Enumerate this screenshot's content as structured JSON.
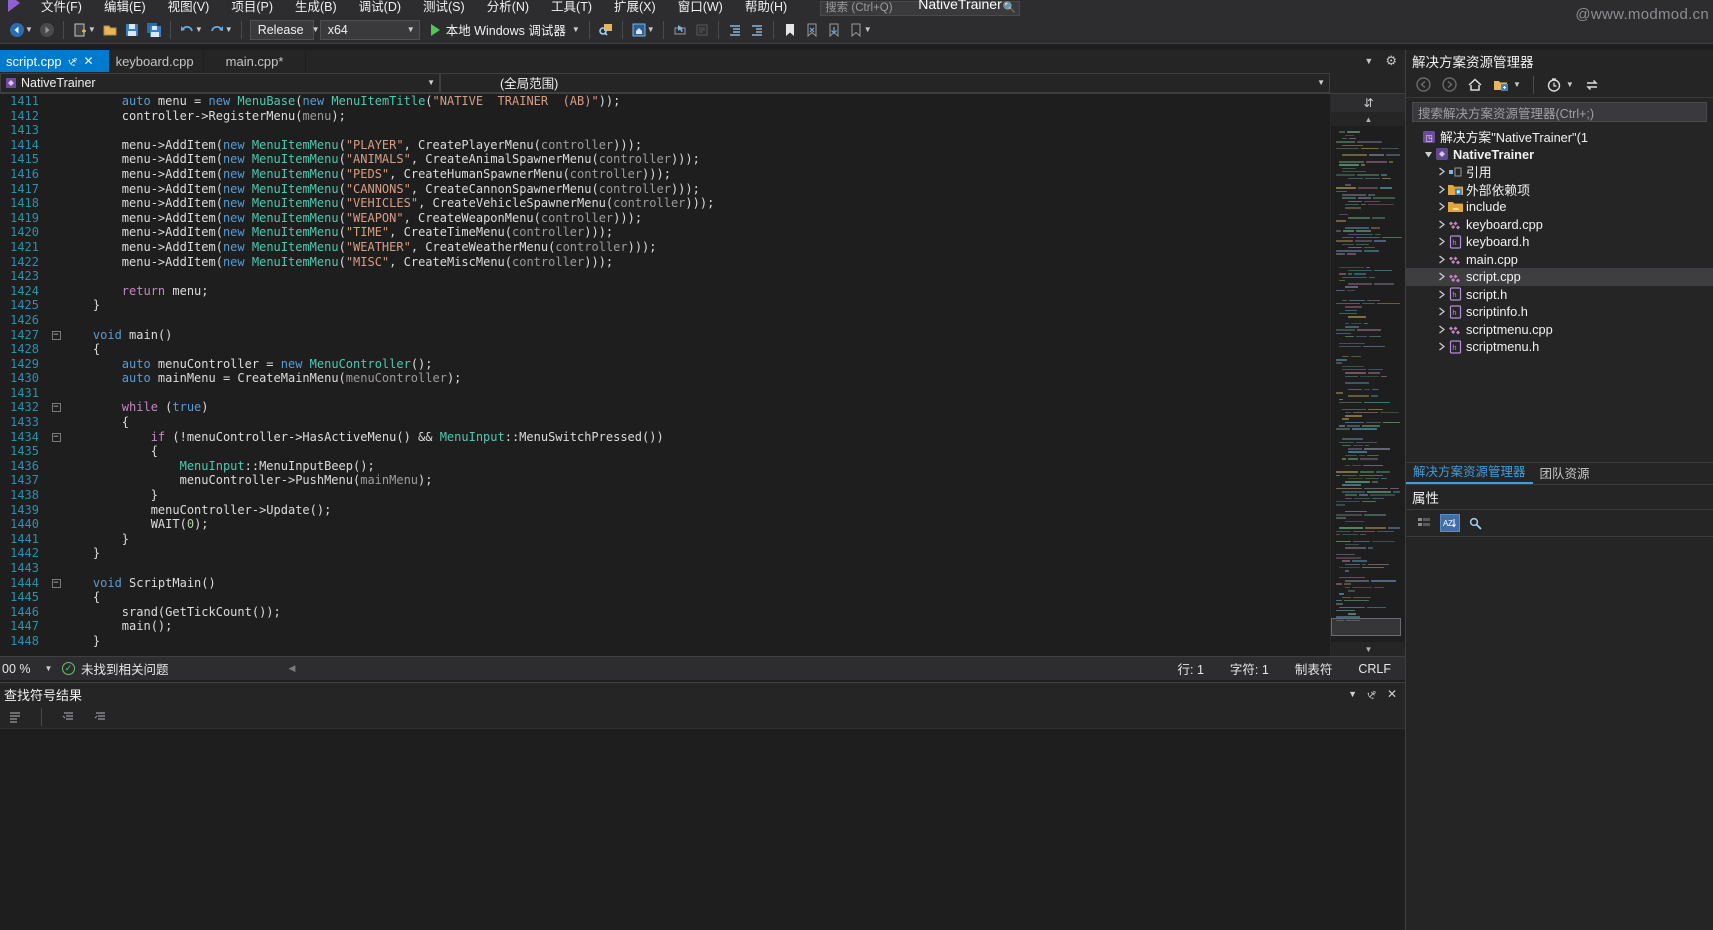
{
  "watermark": "@www.modmod.cn",
  "menubar": {
    "items": [
      {
        "label": "文件(F)"
      },
      {
        "label": "编辑(E)"
      },
      {
        "label": "视图(V)"
      },
      {
        "label": "项目(P)"
      },
      {
        "label": "生成(B)"
      },
      {
        "label": "调试(D)"
      },
      {
        "label": "测试(S)"
      },
      {
        "label": "分析(N)"
      },
      {
        "label": "工具(T)"
      },
      {
        "label": "扩展(X)"
      },
      {
        "label": "窗口(W)"
      },
      {
        "label": "帮助(H)"
      }
    ],
    "search_placeholder": "搜索 (Ctrl+Q)",
    "window_title": "NativeTrainer"
  },
  "toolbar": {
    "configuration": "Release",
    "platform": "x64",
    "debug_target": "本地 Windows 调试器",
    "icons": [
      "navigate-back-icon",
      "navigate-forward-icon",
      "new-file-icon",
      "open-file-icon",
      "save-icon",
      "save-all-icon",
      "undo-icon",
      "redo-icon"
    ]
  },
  "tabs": [
    {
      "label": "script.cpp",
      "active": true,
      "pinned": true,
      "closable": true
    },
    {
      "label": "keyboard.cpp",
      "active": false
    },
    {
      "label": "main.cpp*",
      "active": false
    }
  ],
  "navbar": {
    "project_scope": "NativeTrainer",
    "member_scope": "(全局范围)"
  },
  "editor": {
    "first_line": 1411,
    "lines": [
      {
        "n": 1411,
        "fold": "",
        "seg": [
          {
            "t": "        ",
            "c": "d"
          },
          {
            "t": "auto",
            "c": "k"
          },
          {
            "t": " menu = ",
            "c": "d"
          },
          {
            "t": "new",
            "c": "k"
          },
          {
            "t": " ",
            "c": "d"
          },
          {
            "t": "MenuBase",
            "c": "t"
          },
          {
            "t": "(",
            "c": "d"
          },
          {
            "t": "new",
            "c": "k"
          },
          {
            "t": " ",
            "c": "d"
          },
          {
            "t": "MenuItemTitle",
            "c": "t"
          },
          {
            "t": "(",
            "c": "d"
          },
          {
            "t": "\"NATIVE  TRAINER  (AB)\"",
            "c": "s"
          },
          {
            "t": "));",
            "c": "d"
          }
        ]
      },
      {
        "n": 1412,
        "fold": "",
        "seg": [
          {
            "t": "        controller->",
            "c": "d"
          },
          {
            "t": "RegisterMenu",
            "c": "d"
          },
          {
            "t": "(",
            "c": "d"
          },
          {
            "t": "menu",
            "c": "p"
          },
          {
            "t": ");",
            "c": "d"
          }
        ]
      },
      {
        "n": 1413,
        "fold": "",
        "seg": []
      },
      {
        "n": 1414,
        "fold": "",
        "seg": [
          {
            "t": "        menu->AddItem(",
            "c": "d"
          },
          {
            "t": "new",
            "c": "k"
          },
          {
            "t": " ",
            "c": "d"
          },
          {
            "t": "MenuItemMenu",
            "c": "t"
          },
          {
            "t": "(",
            "c": "d"
          },
          {
            "t": "\"PLAYER\"",
            "c": "s"
          },
          {
            "t": ", CreatePlayerMenu(",
            "c": "d"
          },
          {
            "t": "controller",
            "c": "p"
          },
          {
            "t": ")));",
            "c": "d"
          }
        ]
      },
      {
        "n": 1415,
        "fold": "",
        "seg": [
          {
            "t": "        menu->AddItem(",
            "c": "d"
          },
          {
            "t": "new",
            "c": "k"
          },
          {
            "t": " ",
            "c": "d"
          },
          {
            "t": "MenuItemMenu",
            "c": "t"
          },
          {
            "t": "(",
            "c": "d"
          },
          {
            "t": "\"ANIMALS\"",
            "c": "s"
          },
          {
            "t": ", CreateAnimalSpawnerMenu(",
            "c": "d"
          },
          {
            "t": "controller",
            "c": "p"
          },
          {
            "t": ")));",
            "c": "d"
          }
        ]
      },
      {
        "n": 1416,
        "fold": "",
        "seg": [
          {
            "t": "        menu->AddItem(",
            "c": "d"
          },
          {
            "t": "new",
            "c": "k"
          },
          {
            "t": " ",
            "c": "d"
          },
          {
            "t": "MenuItemMenu",
            "c": "t"
          },
          {
            "t": "(",
            "c": "d"
          },
          {
            "t": "\"PEDS\"",
            "c": "s"
          },
          {
            "t": ", CreateHumanSpawnerMenu(",
            "c": "d"
          },
          {
            "t": "controller",
            "c": "p"
          },
          {
            "t": ")));",
            "c": "d"
          }
        ]
      },
      {
        "n": 1417,
        "fold": "",
        "seg": [
          {
            "t": "        menu->AddItem(",
            "c": "d"
          },
          {
            "t": "new",
            "c": "k"
          },
          {
            "t": " ",
            "c": "d"
          },
          {
            "t": "MenuItemMenu",
            "c": "t"
          },
          {
            "t": "(",
            "c": "d"
          },
          {
            "t": "\"CANNONS\"",
            "c": "s"
          },
          {
            "t": ", CreateCannonSpawnerMenu(",
            "c": "d"
          },
          {
            "t": "controller",
            "c": "p"
          },
          {
            "t": ")));",
            "c": "d"
          }
        ]
      },
      {
        "n": 1418,
        "fold": "",
        "seg": [
          {
            "t": "        menu->AddItem(",
            "c": "d"
          },
          {
            "t": "new",
            "c": "k"
          },
          {
            "t": " ",
            "c": "d"
          },
          {
            "t": "MenuItemMenu",
            "c": "t"
          },
          {
            "t": "(",
            "c": "d"
          },
          {
            "t": "\"VEHICLES\"",
            "c": "s"
          },
          {
            "t": ", CreateVehicleSpawnerMenu(",
            "c": "d"
          },
          {
            "t": "controller",
            "c": "p"
          },
          {
            "t": ")));",
            "c": "d"
          }
        ]
      },
      {
        "n": 1419,
        "fold": "",
        "seg": [
          {
            "t": "        menu->AddItem(",
            "c": "d"
          },
          {
            "t": "new",
            "c": "k"
          },
          {
            "t": " ",
            "c": "d"
          },
          {
            "t": "MenuItemMenu",
            "c": "t"
          },
          {
            "t": "(",
            "c": "d"
          },
          {
            "t": "\"WEAPON\"",
            "c": "s"
          },
          {
            "t": ", CreateWeaponMenu(",
            "c": "d"
          },
          {
            "t": "controller",
            "c": "p"
          },
          {
            "t": ")));",
            "c": "d"
          }
        ]
      },
      {
        "n": 1420,
        "fold": "",
        "seg": [
          {
            "t": "        menu->AddItem(",
            "c": "d"
          },
          {
            "t": "new",
            "c": "k"
          },
          {
            "t": " ",
            "c": "d"
          },
          {
            "t": "MenuItemMenu",
            "c": "t"
          },
          {
            "t": "(",
            "c": "d"
          },
          {
            "t": "\"TIME\"",
            "c": "s"
          },
          {
            "t": ", CreateTimeMenu(",
            "c": "d"
          },
          {
            "t": "controller",
            "c": "p"
          },
          {
            "t": ")));",
            "c": "d"
          }
        ]
      },
      {
        "n": 1421,
        "fold": "",
        "seg": [
          {
            "t": "        menu->AddItem(",
            "c": "d"
          },
          {
            "t": "new",
            "c": "k"
          },
          {
            "t": " ",
            "c": "d"
          },
          {
            "t": "MenuItemMenu",
            "c": "t"
          },
          {
            "t": "(",
            "c": "d"
          },
          {
            "t": "\"WEATHER\"",
            "c": "s"
          },
          {
            "t": ", CreateWeatherMenu(",
            "c": "d"
          },
          {
            "t": "controller",
            "c": "p"
          },
          {
            "t": ")));",
            "c": "d"
          }
        ]
      },
      {
        "n": 1422,
        "fold": "",
        "seg": [
          {
            "t": "        menu->AddItem(",
            "c": "d"
          },
          {
            "t": "new",
            "c": "k"
          },
          {
            "t": " ",
            "c": "d"
          },
          {
            "t": "MenuItemMenu",
            "c": "t"
          },
          {
            "t": "(",
            "c": "d"
          },
          {
            "t": "\"MISC\"",
            "c": "s"
          },
          {
            "t": ", CreateMiscMenu(",
            "c": "d"
          },
          {
            "t": "controller",
            "c": "p"
          },
          {
            "t": ")));",
            "c": "d"
          }
        ]
      },
      {
        "n": 1423,
        "fold": "",
        "seg": []
      },
      {
        "n": 1424,
        "fold": "",
        "seg": [
          {
            "t": "        ",
            "c": "d"
          },
          {
            "t": "return",
            "c": "kp"
          },
          {
            "t": " menu;",
            "c": "d"
          }
        ]
      },
      {
        "n": 1425,
        "fold": "",
        "seg": [
          {
            "t": "    }",
            "c": "d"
          }
        ]
      },
      {
        "n": 1426,
        "fold": "",
        "seg": []
      },
      {
        "n": 1427,
        "fold": "-",
        "seg": [
          {
            "t": "    ",
            "c": "d"
          },
          {
            "t": "void",
            "c": "k"
          },
          {
            "t": " ",
            "c": "d"
          },
          {
            "t": "main",
            "c": "d"
          },
          {
            "t": "()",
            "c": "d"
          }
        ]
      },
      {
        "n": 1428,
        "fold": "",
        "seg": [
          {
            "t": "    {",
            "c": "d"
          }
        ]
      },
      {
        "n": 1429,
        "fold": "",
        "seg": [
          {
            "t": "        ",
            "c": "d"
          },
          {
            "t": "auto",
            "c": "k"
          },
          {
            "t": " menuController = ",
            "c": "d"
          },
          {
            "t": "new",
            "c": "k"
          },
          {
            "t": " ",
            "c": "d"
          },
          {
            "t": "MenuController",
            "c": "t"
          },
          {
            "t": "();",
            "c": "d"
          }
        ]
      },
      {
        "n": 1430,
        "fold": "",
        "seg": [
          {
            "t": "        ",
            "c": "d"
          },
          {
            "t": "auto",
            "c": "k"
          },
          {
            "t": " mainMenu = CreateMainMenu(",
            "c": "d"
          },
          {
            "t": "menuController",
            "c": "p"
          },
          {
            "t": ");",
            "c": "d"
          }
        ]
      },
      {
        "n": 1431,
        "fold": "",
        "seg": []
      },
      {
        "n": 1432,
        "fold": "-",
        "seg": [
          {
            "t": "        ",
            "c": "d"
          },
          {
            "t": "while",
            "c": "kp"
          },
          {
            "t": " (",
            "c": "d"
          },
          {
            "t": "true",
            "c": "k"
          },
          {
            "t": ")",
            "c": "d"
          }
        ]
      },
      {
        "n": 1433,
        "fold": "",
        "seg": [
          {
            "t": "        {",
            "c": "d"
          }
        ]
      },
      {
        "n": 1434,
        "fold": "-",
        "seg": [
          {
            "t": "            ",
            "c": "d"
          },
          {
            "t": "if",
            "c": "kp"
          },
          {
            "t": " (!menuController->HasActiveMenu() && ",
            "c": "d"
          },
          {
            "t": "MenuInput",
            "c": "t"
          },
          {
            "t": "::MenuSwitchPressed())",
            "c": "d"
          }
        ]
      },
      {
        "n": 1435,
        "fold": "",
        "seg": [
          {
            "t": "            {",
            "c": "d"
          }
        ]
      },
      {
        "n": 1436,
        "fold": "",
        "seg": [
          {
            "t": "                ",
            "c": "d"
          },
          {
            "t": "MenuInput",
            "c": "t"
          },
          {
            "t": "::MenuInputBeep();",
            "c": "d"
          }
        ]
      },
      {
        "n": 1437,
        "fold": "",
        "seg": [
          {
            "t": "                menuController->PushMenu(",
            "c": "d"
          },
          {
            "t": "mainMenu",
            "c": "p"
          },
          {
            "t": ");",
            "c": "d"
          }
        ]
      },
      {
        "n": 1438,
        "fold": "",
        "seg": [
          {
            "t": "            }",
            "c": "d"
          }
        ]
      },
      {
        "n": 1439,
        "fold": "",
        "seg": [
          {
            "t": "            menuController->Update();",
            "c": "d"
          }
        ]
      },
      {
        "n": 1440,
        "fold": "",
        "seg": [
          {
            "t": "            WAIT(",
            "c": "d"
          },
          {
            "t": "0",
            "c": "n"
          },
          {
            "t": ");",
            "c": "d"
          }
        ]
      },
      {
        "n": 1441,
        "fold": "",
        "seg": [
          {
            "t": "        }",
            "c": "d"
          }
        ]
      },
      {
        "n": 1442,
        "fold": "",
        "seg": [
          {
            "t": "    }",
            "c": "d"
          }
        ]
      },
      {
        "n": 1443,
        "fold": "",
        "seg": []
      },
      {
        "n": 1444,
        "fold": "-",
        "seg": [
          {
            "t": "    ",
            "c": "d"
          },
          {
            "t": "void",
            "c": "k"
          },
          {
            "t": " ScriptMain()",
            "c": "d"
          }
        ]
      },
      {
        "n": 1445,
        "fold": "",
        "seg": [
          {
            "t": "    {",
            "c": "d"
          }
        ]
      },
      {
        "n": 1446,
        "fold": "",
        "seg": [
          {
            "t": "        srand(GetTickCount());",
            "c": "d"
          }
        ]
      },
      {
        "n": 1447,
        "fold": "",
        "seg": [
          {
            "t": "        main();",
            "c": "d"
          }
        ]
      },
      {
        "n": 1448,
        "fold": "",
        "seg": [
          {
            "t": "    }",
            "c": "d"
          }
        ]
      }
    ]
  },
  "editor_status": {
    "zoom": "00 %",
    "issue_text": "未找到相关问题",
    "line": "行: 1",
    "column": "字符: 1",
    "tabs_mode": "制表符",
    "eol": "CRLF"
  },
  "find_panel": {
    "title": "查找符号结果"
  },
  "solution_explorer": {
    "title": "解决方案资源管理器",
    "search_placeholder": "搜索解决方案资源管理器(Ctrl+;)",
    "toolbar_icons": [
      "back-icon",
      "forward-icon",
      "home-icon",
      "show-all-files-icon",
      "pending-changes-icon",
      "sync-icon"
    ],
    "tree": [
      {
        "label": "解决方案\"NativeTrainer\"(1",
        "indent": 0,
        "arrow": "",
        "icon": "solution-icon",
        "bold": false
      },
      {
        "label": "NativeTrainer",
        "indent": 1,
        "arrow": "open",
        "icon": "project-icon",
        "bold": true
      },
      {
        "label": "引用",
        "indent": 2,
        "arrow": "closed",
        "icon": "references-icon",
        "bold": false
      },
      {
        "label": "外部依赖项",
        "indent": 2,
        "arrow": "closed",
        "icon": "folder-dep-icon",
        "bold": false
      },
      {
        "label": "include",
        "indent": 2,
        "arrow": "closed",
        "icon": "folder-icon",
        "bold": false
      },
      {
        "label": "keyboard.cpp",
        "indent": 2,
        "arrow": "closed",
        "icon": "cpp-icon",
        "bold": false
      },
      {
        "label": "keyboard.h",
        "indent": 2,
        "arrow": "closed",
        "icon": "header-icon",
        "bold": false
      },
      {
        "label": "main.cpp",
        "indent": 2,
        "arrow": "closed",
        "icon": "cpp-icon",
        "bold": false
      },
      {
        "label": "script.cpp",
        "indent": 2,
        "arrow": "closed",
        "icon": "cpp-icon",
        "bold": false,
        "selected": true
      },
      {
        "label": "script.h",
        "indent": 2,
        "arrow": "closed",
        "icon": "header-icon",
        "bold": false
      },
      {
        "label": "scriptinfo.h",
        "indent": 2,
        "arrow": "closed",
        "icon": "header-icon",
        "bold": false
      },
      {
        "label": "scriptmenu.cpp",
        "indent": 2,
        "arrow": "closed",
        "icon": "cpp-icon",
        "bold": false
      },
      {
        "label": "scriptmenu.h",
        "indent": 2,
        "arrow": "closed",
        "icon": "header-icon",
        "bold": false
      }
    ],
    "bottom_tabs": [
      {
        "label": "解决方案资源管理器",
        "active": true
      },
      {
        "label": "团队资源",
        "active": false
      }
    ]
  },
  "properties": {
    "title": "属性",
    "toolbar_icons": [
      "categorized-icon",
      "alphabetical-icon",
      "properties-icon"
    ]
  },
  "colors": {
    "accent": "#007acc",
    "bg": "#1e1e1e",
    "chrome": "#2d2d30",
    "panel": "#252526",
    "string": "#d69d85",
    "keyword": "#569cd6",
    "type": "#4ec9b0",
    "control_keyword": "#c586c0",
    "linenumber": "#2b91af",
    "cpp_icon": "#c586c0",
    "ok_green": "#6fbf6f"
  }
}
